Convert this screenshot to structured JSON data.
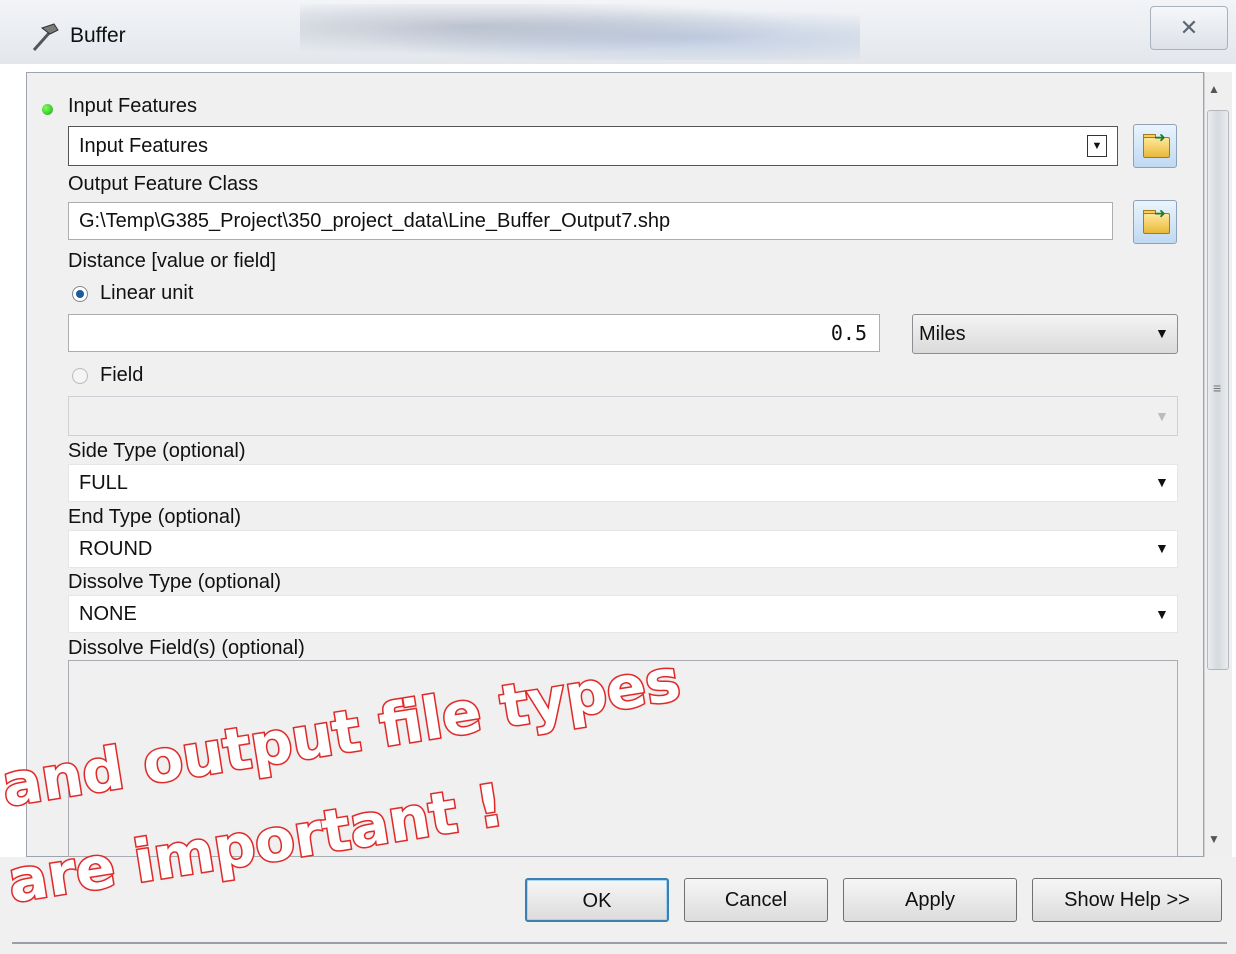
{
  "window": {
    "title": "Buffer",
    "close_glyph": "✕"
  },
  "form": {
    "input_features": {
      "label": "Input Features",
      "value": "Input Features"
    },
    "output_feature_class": {
      "label": "Output Feature Class",
      "value": "G:\\Temp\\G385_Project\\350_project_data\\Line_Buffer_Output7.shp"
    },
    "distance": {
      "label": "Distance [value or field]",
      "linear_unit_label": "Linear unit",
      "linear_value": "0.5",
      "unit": "Miles",
      "field_label": "Field",
      "field_value": ""
    },
    "side_type": {
      "label": "Side Type (optional)",
      "value": "FULL"
    },
    "end_type": {
      "label": "End Type (optional)",
      "value": "ROUND"
    },
    "dissolve_type": {
      "label": "Dissolve Type (optional)",
      "value": "NONE"
    },
    "dissolve_fields": {
      "label": "Dissolve Field(s) (optional)"
    }
  },
  "buttons": {
    "ok": "OK",
    "cancel": "Cancel",
    "apply": "Apply",
    "help": "Show Help >>"
  },
  "annotation": {
    "line1": "and output file types",
    "line2": "are important !"
  },
  "colors": {
    "annotation_red": "#e02a2a",
    "required_dot": "#18a81c",
    "default_button_border": "#3c7fb1"
  },
  "icons": {
    "window": "hammer-icon",
    "browse": "open-folder-icon",
    "dropdown": "chevron-down-icon"
  }
}
